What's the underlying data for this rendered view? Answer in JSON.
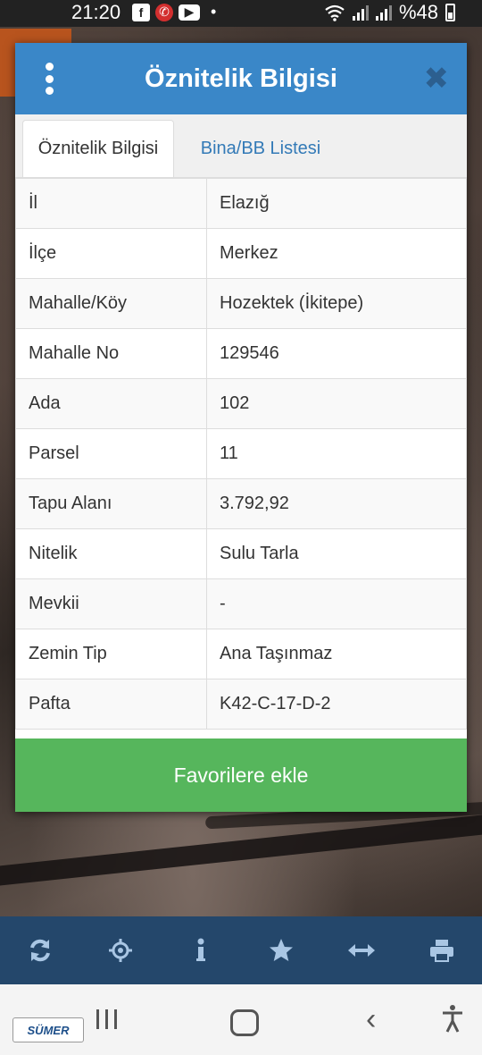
{
  "status_bar": {
    "time": "21:20",
    "battery": "%48"
  },
  "dialog": {
    "title": "Öznitelik Bilgisi",
    "tabs": [
      {
        "label": "Öznitelik Bilgisi",
        "active": true
      },
      {
        "label": "Bina/BB Listesi",
        "active": false
      }
    ],
    "rows": [
      {
        "key": "İl",
        "value": "Elazığ"
      },
      {
        "key": "İlçe",
        "value": "Merkez"
      },
      {
        "key": "Mahalle/Köy",
        "value": "Hozektek (İkitepe)"
      },
      {
        "key": "Mahalle No",
        "value": "129546"
      },
      {
        "key": "Ada",
        "value": "102"
      },
      {
        "key": "Parsel",
        "value": "11"
      },
      {
        "key": "Tapu Alanı",
        "value": "3.792,92"
      },
      {
        "key": "Nitelik",
        "value": "Sulu Tarla"
      },
      {
        "key": "Mevkii",
        "value": "-"
      },
      {
        "key": "Zemin Tip",
        "value": "Ana Taşınmaz"
      },
      {
        "key": "Pafta",
        "value": "K42-C-17-D-2"
      }
    ],
    "favorite_button": "Favorilere ekle"
  },
  "toolbar": {
    "tools": [
      "refresh-icon",
      "locate-icon",
      "info-icon",
      "star-icon",
      "measure-icon",
      "print-icon"
    ]
  },
  "nav_logo": "SÜMER",
  "colors": {
    "header": "#3a87c8",
    "favorite_button": "#56b65c",
    "toolbar": "#24476b",
    "toolbar_icon": "#a9c6e4",
    "tab_link": "#337ab7"
  }
}
